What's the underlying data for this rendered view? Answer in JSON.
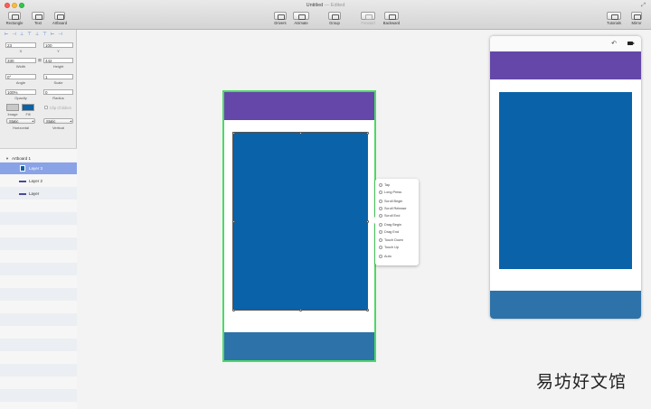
{
  "window": {
    "title": "Untitled",
    "status": "— Edited"
  },
  "toolbar": {
    "left": [
      {
        "label": "Rectangle",
        "icon": "rectangle-icon"
      },
      {
        "label": "Text",
        "icon": "text-icon"
      },
      {
        "label": "Artboard",
        "icon": "artboard-icon"
      }
    ],
    "center": [
      {
        "label": "Drivers",
        "icon": "drivers-icon"
      },
      {
        "label": "Animate",
        "icon": "animate-icon"
      },
      {
        "label": "Group",
        "icon": "group-icon"
      },
      {
        "label": "Forward",
        "icon": "forward-icon"
      },
      {
        "label": "Backward",
        "icon": "backward-icon"
      }
    ],
    "right": [
      {
        "label": "Tutorials",
        "icon": "tutorials-icon"
      },
      {
        "label": "Mirror",
        "icon": "mirror-icon"
      }
    ]
  },
  "inspector": {
    "x": "23",
    "x_label": "X",
    "y": "100",
    "y_label": "Y",
    "width": "330",
    "width_label": "Width",
    "height": "442",
    "height_label": "Height",
    "angle": "0°",
    "angle_label": "Angle",
    "scale": "1",
    "scale_label": "Scale",
    "opacity": "100%",
    "opacity_label": "Opacity",
    "radius": "0",
    "radius_label": "Radius",
    "image_label": "Image",
    "fill_label": "Fill",
    "clip_children": "Clip Children",
    "horizontal": "Static",
    "horizontal_label": "Horizontal",
    "vertical": "Static",
    "vertical_label": "Vertical",
    "fill_color": "#0a62a8"
  },
  "layers": {
    "artboard": "Artboard 1",
    "items": [
      {
        "name": "Layer 3",
        "selected": true
      },
      {
        "name": "Layer 2",
        "selected": false
      },
      {
        "name": "Layer",
        "selected": false
      }
    ]
  },
  "trigger_menu": [
    "Tap",
    "Long Press",
    "Scroll Begin",
    "Scroll Release",
    "Scroll End",
    "Drag Begin",
    "Drag End",
    "Touch Down",
    "Touch Up",
    "Auto"
  ],
  "colors": {
    "header": "#6447a8",
    "body": "#0a62a8",
    "footer": "#2d72a8",
    "selection": "#4cd964"
  },
  "watermark": "易坊好文馆"
}
